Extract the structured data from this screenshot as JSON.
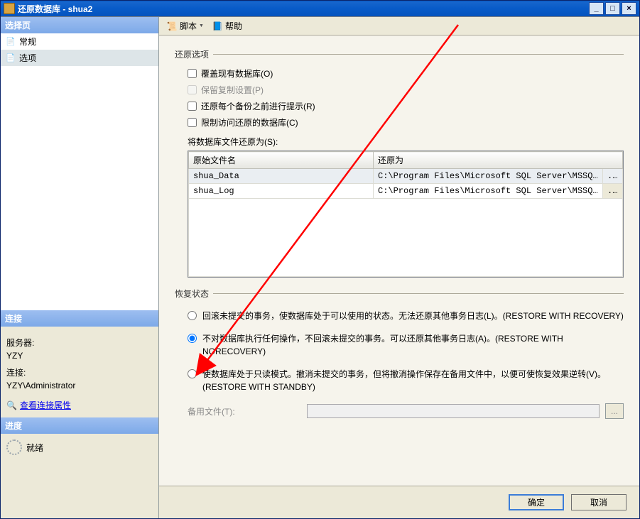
{
  "window": {
    "title": "还原数据库 - shua2"
  },
  "winbtns": {
    "min": "_",
    "max": "□",
    "close": "×"
  },
  "left": {
    "selectHeader": "选择页",
    "nav": {
      "general": "常规",
      "options": "选项"
    },
    "connHeader": "连接",
    "serverLabel": "服务器:",
    "serverValue": "YZY",
    "connLabel": "连接:",
    "connValue": "YZY\\Administrator",
    "viewProps": "查看连接属性",
    "progressHeader": "进度",
    "progressValue": "就绪"
  },
  "toolbar": {
    "script": "脚本",
    "help": "帮助"
  },
  "restoreOptions": {
    "header": "还原选项",
    "overwrite": "覆盖现有数据库(O)",
    "preserveReplication": "保留复制设置(P)",
    "promptBefore": "还原每个备份之前进行提示(R)",
    "restrict": "限制访问还原的数据库(C)",
    "restoreAsLabel": "将数据库文件还原为(S):",
    "colOriginal": "原始文件名",
    "colRestoreAs": "还原为",
    "rows": [
      {
        "original": "shua_Data",
        "restore": "C:\\Program Files\\Microsoft SQL Server\\MSSQL..."
      },
      {
        "original": "shua_Log",
        "restore": "C:\\Program Files\\Microsoft SQL Server\\MSSQL..."
      }
    ]
  },
  "recovery": {
    "header": "恢复状态",
    "opt1": "回滚未提交的事务，使数据库处于可以使用的状态。无法还原其他事务日志(L)。(RESTORE WITH RECOVERY)",
    "opt2": "不对数据库执行任何操作，不回滚未提交的事务。可以还原其他事务日志(A)。(RESTORE WITH NORECOVERY)",
    "opt3": "使数据库处于只读模式。撤消未提交的事务，但将撤消操作保存在备用文件中，以便可使恢复效果逆转(V)。(RESTORE WITH STANDBY)",
    "backupFileLabel": "备用文件(T):"
  },
  "footer": {
    "ok": "确定",
    "cancel": "取消"
  }
}
